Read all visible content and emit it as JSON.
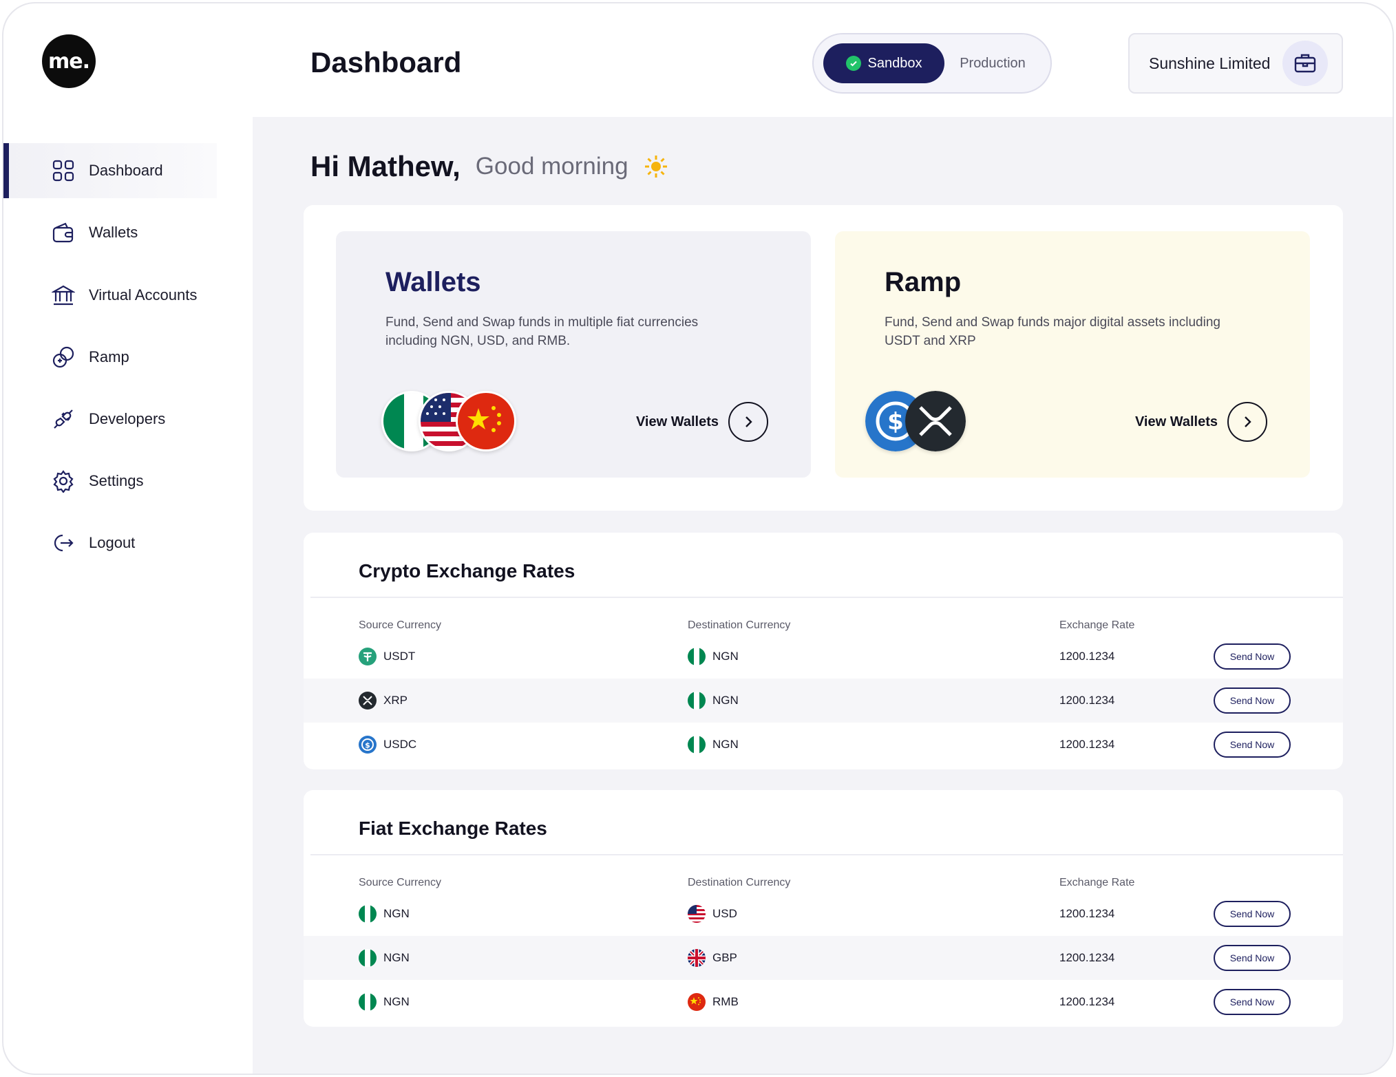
{
  "brand": {
    "logo_text": "me."
  },
  "header": {
    "title": "Dashboard",
    "env": {
      "active": "Sandbox",
      "inactive": "Production"
    },
    "org_name": "Sunshine Limited"
  },
  "sidebar": {
    "items": [
      {
        "label": "Dashboard",
        "icon": "grid-icon",
        "active": true
      },
      {
        "label": "Wallets",
        "icon": "wallet-icon"
      },
      {
        "label": "Virtual Accounts",
        "icon": "bank-icon"
      },
      {
        "label": "Ramp",
        "icon": "ramp-icon"
      },
      {
        "label": "Developers",
        "icon": "plug-icon"
      },
      {
        "label": "Settings",
        "icon": "gear-icon"
      },
      {
        "label": "Logout",
        "icon": "logout-icon"
      }
    ]
  },
  "greeting": {
    "name": "Hi Mathew,",
    "sub": "Good morning"
  },
  "cards": {
    "wallets": {
      "title": "Wallets",
      "desc": "Fund, Send and Swap funds in multiple fiat currencies including NGN, USD, and RMB.",
      "link": "View Wallets"
    },
    "ramp": {
      "title": "Ramp",
      "desc": "Fund, Send and Swap funds major digital assets including USDT and XRP",
      "link": "View Wallets"
    }
  },
  "crypto": {
    "title": "Crypto Exchange Rates",
    "headers": [
      "Source Currency",
      "Destination Currency",
      "Exchange Rate"
    ],
    "rows": [
      {
        "src": "USDT",
        "src_icon": "usdt-icon",
        "dst": "NGN",
        "dst_icon": "nigeria-flag-icon",
        "rate": "1200.1234",
        "action": "Send Now"
      },
      {
        "src": "XRP",
        "src_icon": "xrp-icon",
        "dst": "NGN",
        "dst_icon": "nigeria-flag-icon",
        "rate": "1200.1234",
        "action": "Send Now"
      },
      {
        "src": "USDC",
        "src_icon": "usdc-icon",
        "dst": "NGN",
        "dst_icon": "nigeria-flag-icon",
        "rate": "1200.1234",
        "action": "Send Now"
      }
    ]
  },
  "fiat": {
    "title": "Fiat Exchange Rates",
    "headers": [
      "Source Currency",
      "Destination Currency",
      "Exchange Rate"
    ],
    "rows": [
      {
        "src": "NGN",
        "src_icon": "nigeria-flag-icon",
        "dst": "USD",
        "dst_icon": "us-flag-icon",
        "rate": "1200.1234",
        "action": "Send Now"
      },
      {
        "src": "NGN",
        "src_icon": "nigeria-flag-icon",
        "dst": "GBP",
        "dst_icon": "uk-flag-icon",
        "rate": "1200.1234",
        "action": "Send Now"
      },
      {
        "src": "NGN",
        "src_icon": "nigeria-flag-icon",
        "dst": "RMB",
        "dst_icon": "china-flag-icon",
        "rate": "1200.1234",
        "action": "Send Now"
      }
    ]
  },
  "colors": {
    "navy": "#1d1f5e",
    "green": "#008751",
    "ramp_bg": "#fdfaea"
  }
}
